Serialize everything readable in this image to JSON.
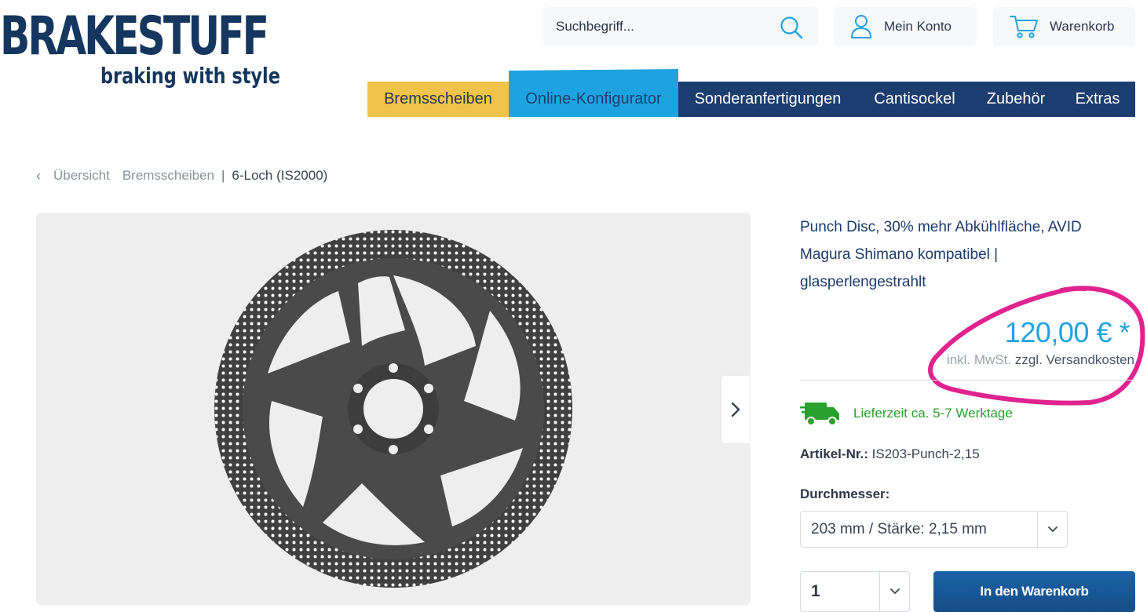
{
  "logo": {
    "main": "BRAKESTUFF",
    "tagline": "braking with style"
  },
  "search": {
    "placeholder": "Suchbegriff...",
    "icon": "search-icon"
  },
  "header": {
    "account_label": "Mein Konto",
    "cart_label": "Warenkorb"
  },
  "nav": {
    "items": [
      {
        "label": "Bremsscheiben",
        "color": "#f0c34a"
      },
      {
        "label": "Online-Konfigurator",
        "color": "#1fa3e0"
      },
      {
        "label": "Sonderanfertigungen"
      },
      {
        "label": "Cantisockel"
      },
      {
        "label": "Zubehör"
      },
      {
        "label": "Extras"
      }
    ],
    "bar_color": "#1c3d70"
  },
  "breadcrumb": {
    "back_label": "Übersicht",
    "items": [
      "Bremsscheiben",
      "6-Loch (IS2000)"
    ]
  },
  "product": {
    "title_lines": [
      "Punch Disc, 30% mehr Abkühlfläche, AVID",
      "Magura Shimano kompatibel |",
      "glasperlengestrahlt"
    ],
    "price": "120,00 € *",
    "vat_note": "inkl. MwSt.",
    "shipping_note": "zzgl. Versandkosten",
    "delivery": "Lieferzeit ca. 5-7 Werktage",
    "sku_label": "Artikel-Nr.:",
    "sku": "IS203-Punch-2,15",
    "diameter_label": "Durchmesser:",
    "diameter_value": "203 mm / Stärke: 2,15 mm",
    "quantity": "1",
    "add_to_cart": "In den Warenkorb"
  },
  "colors": {
    "accent_blue": "#1fa3e0",
    "dark_blue": "#1c3d70",
    "green": "#2aa02f",
    "annotation_pink": "#e0238f"
  }
}
